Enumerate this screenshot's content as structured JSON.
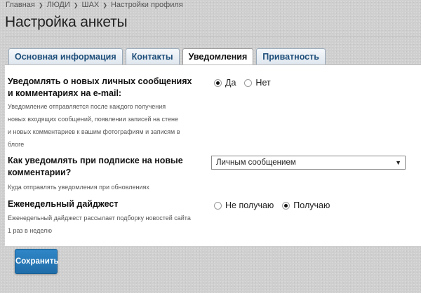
{
  "breadcrumb": {
    "items": [
      "Главная",
      "ЛЮДИ",
      "ШАХ",
      "Настройки профиля"
    ]
  },
  "page": {
    "title": "Настройка анкеты"
  },
  "tabs": [
    {
      "label": "Основная информация",
      "active": false
    },
    {
      "label": "Контакты",
      "active": false
    },
    {
      "label": "Уведомления",
      "active": true
    },
    {
      "label": "Приватность",
      "active": false
    }
  ],
  "settings": {
    "email_notify": {
      "label_line1": "Уведомлять о новых личных сообщениях",
      "label_line2": "и комментариях на e-mail:",
      "desc_line1": "Уведомление отправляется после каждого получения",
      "desc_line2": "новых входящих сообщений, появлении записей на стене",
      "desc_line3": "и новых комментариев к вашим фотографиям и записям в",
      "desc_line4": "блоге",
      "options": [
        "Да",
        "Нет"
      ],
      "selected": "Да"
    },
    "subscription_notify": {
      "label_line1": "Как уведомлять при подписке на новые",
      "label_line2": "комментарии?",
      "desc": "Куда отправлять уведомления при обновлениях",
      "selected_value": "Личным сообщением"
    },
    "weekly_digest": {
      "label": "Еженедельный дайджест",
      "desc_line1": "Еженедельный дайджест рассылает подборку новостей сайта",
      "desc_line2": "1 раз в неделю",
      "options": [
        "Не получаю",
        "Получаю"
      ],
      "selected": "Получаю"
    }
  },
  "actions": {
    "save_label": "Сохранить"
  },
  "colors": {
    "accent": "#2a7dbf",
    "tab_text": "#1e4e7a"
  }
}
